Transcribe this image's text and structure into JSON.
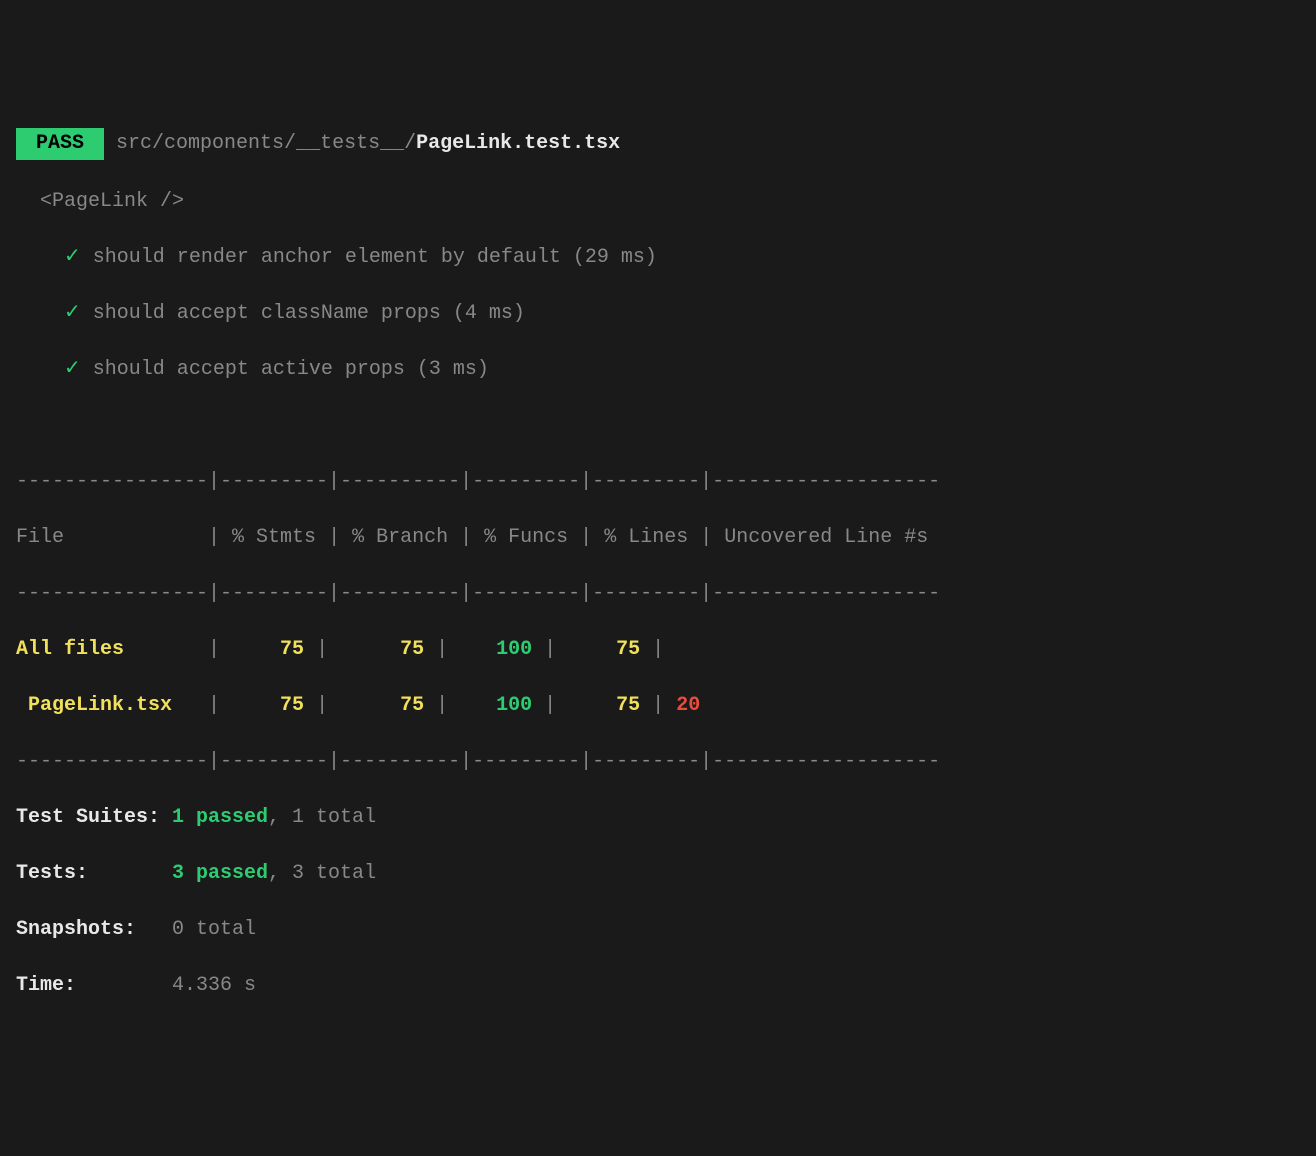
{
  "header": {
    "badge": " PASS ",
    "path_prefix": "src/components/__tests__/",
    "filename": "PageLink.test.tsx"
  },
  "suite": {
    "name": "<PageLink />",
    "tests": [
      {
        "desc": "should render anchor element by default (29 ms)"
      },
      {
        "desc": "should accept className props (4 ms)"
      },
      {
        "desc": "should accept active props (3 ms)"
      }
    ]
  },
  "coverage": {
    "rule": "----------------|---------|----------|---------|---------|-------------------",
    "header": {
      "file": "File            ",
      "stmts": " % Stmts ",
      "branch": " % Branch ",
      "funcs": " % Funcs ",
      "lines": " % Lines ",
      "uncovered": " Uncovered Line #s "
    },
    "rows": [
      {
        "file_class": "yellow",
        "file": "All files       ",
        "stmts": "     75 ",
        "stmts_class": "yellow",
        "branch": "      75 ",
        "branch_class": "yellow",
        "funcs": "    100 ",
        "funcs_class": "green",
        "lines": "     75 ",
        "lines_class": "yellow",
        "uncovered": "                   ",
        "uncovered_class": "dim"
      },
      {
        "file_class": "yellow",
        "file": " PageLink.tsx   ",
        "stmts": "     75 ",
        "stmts_class": "yellow",
        "branch": "      75 ",
        "branch_class": "yellow",
        "funcs": "    100 ",
        "funcs_class": "green",
        "lines": "     75 ",
        "lines_class": "yellow",
        "uncovered": " 20",
        "uncovered_class": "red"
      }
    ]
  },
  "summary": {
    "suites_label": "Test Suites: ",
    "suites_passed": "1 passed",
    "suites_total": ", 1 total",
    "tests_label": "Tests:       ",
    "tests_passed": "3 passed",
    "tests_total": ", 3 total",
    "snapshots_label": "Snapshots:   ",
    "snapshots_value": "0 total",
    "time_label": "Time:        ",
    "time_value": "4.336 s"
  }
}
